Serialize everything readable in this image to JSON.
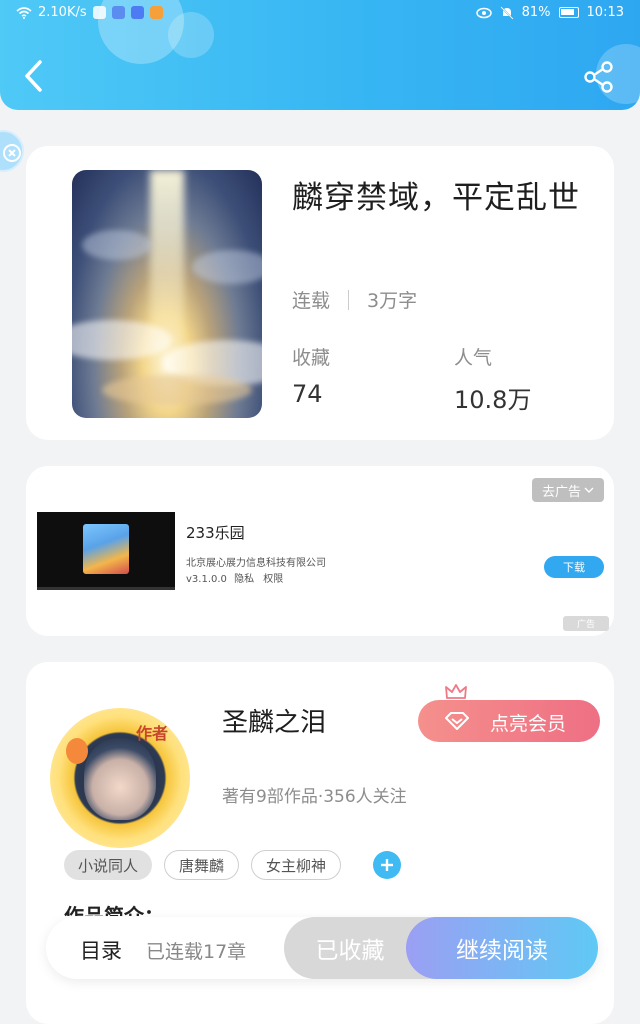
{
  "status_bar": {
    "speed": "2.10K/s",
    "battery": "81%",
    "time": "10:13"
  },
  "header": {
    "back_icon": "chevron-left-icon",
    "share_icon": "share-icon"
  },
  "book": {
    "title": "麟穿禁域，平定乱世",
    "status": "连载",
    "word_count": "3万字",
    "favorites_label": "收藏",
    "favorites_value": "74",
    "popularity_label": "人气",
    "popularity_value": "10.8万"
  },
  "ad": {
    "remove_label": "去广告",
    "app_name": "233乐园",
    "company": "北京展心展力信息科技有限公司",
    "version": "v3.1.0.0",
    "privacy": "隐私",
    "permissions": "权限",
    "download_label": "下载",
    "ad_tag": "广告"
  },
  "author": {
    "badge": "作者",
    "name": "圣麟之泪",
    "vip_label": "点亮会员",
    "works": "著有9部作品",
    "followers": "356人关注",
    "tags": [
      "小说同人",
      "唐舞麟",
      "女主柳神"
    ],
    "intro_label": "作品简介："
  },
  "bottom_bar": {
    "toc_label": "目录",
    "chapters_label": "已连载17章",
    "favorite_label": "已收藏",
    "read_label": "继续阅读"
  },
  "colors": {
    "header_blue": "#37b6f3",
    "vip_pink": "#ee6f84",
    "read_gradient_start": "#9b9ff3",
    "read_gradient_end": "#5fc9f5"
  }
}
